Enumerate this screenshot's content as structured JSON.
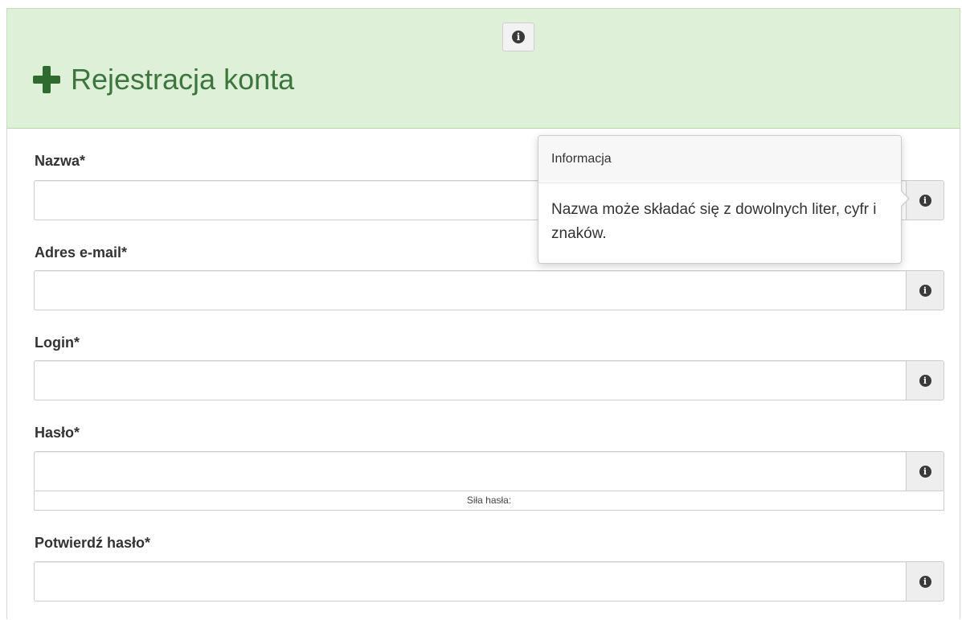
{
  "header": {
    "title": "Rejestracja konta"
  },
  "form": {
    "fields": [
      {
        "label": "Nazwa*",
        "value": "",
        "placeholder": ""
      },
      {
        "label": "Adres e-mail*",
        "value": "",
        "placeholder": ""
      },
      {
        "label": "Login*",
        "value": "",
        "placeholder": ""
      },
      {
        "label": "Hasło*",
        "value": "",
        "placeholder": ""
      },
      {
        "label": "Potwierdź hasło*",
        "value": "",
        "placeholder": ""
      }
    ],
    "password_strength_label": "Siła hasła:"
  },
  "popover": {
    "title": "Informacja",
    "body": "Nazwa może składać się z dowolnych liter, cyfr i znaków."
  },
  "icons": {
    "header_info": "info-icon",
    "field_info": "info-icon",
    "title_icon": "plus-icon",
    "info_glyph": "i"
  },
  "colors": {
    "header_bg": "#dff0d8",
    "title_color": "#3c763d",
    "plus_color": "#2f6b2f"
  }
}
